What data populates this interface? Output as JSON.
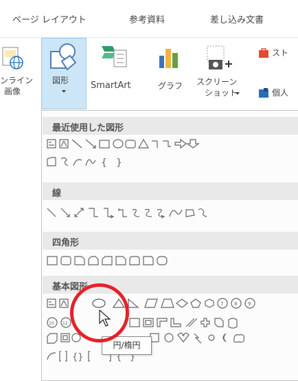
{
  "tabs": [
    "ページ レイアウト",
    "参考資料",
    "差し込み文書"
  ],
  "ribbon": {
    "online_image_label": [
      "ンライン",
      "画像"
    ],
    "shapes_label": "図形",
    "smartart_label": "SmartArt",
    "chart_label": "グラフ",
    "screenshot_label": [
      "スクリーン",
      "ショット"
    ],
    "store_label": "スト",
    "personal_label": "個人"
  },
  "gallery": {
    "categories": [
      "最近使用した図形",
      "線",
      "四角形",
      "基本図形"
    ]
  },
  "tooltip": "円/楕円",
  "colors": {
    "accent_blue": "#cde6f7",
    "highlight_red": "#e8202a"
  }
}
